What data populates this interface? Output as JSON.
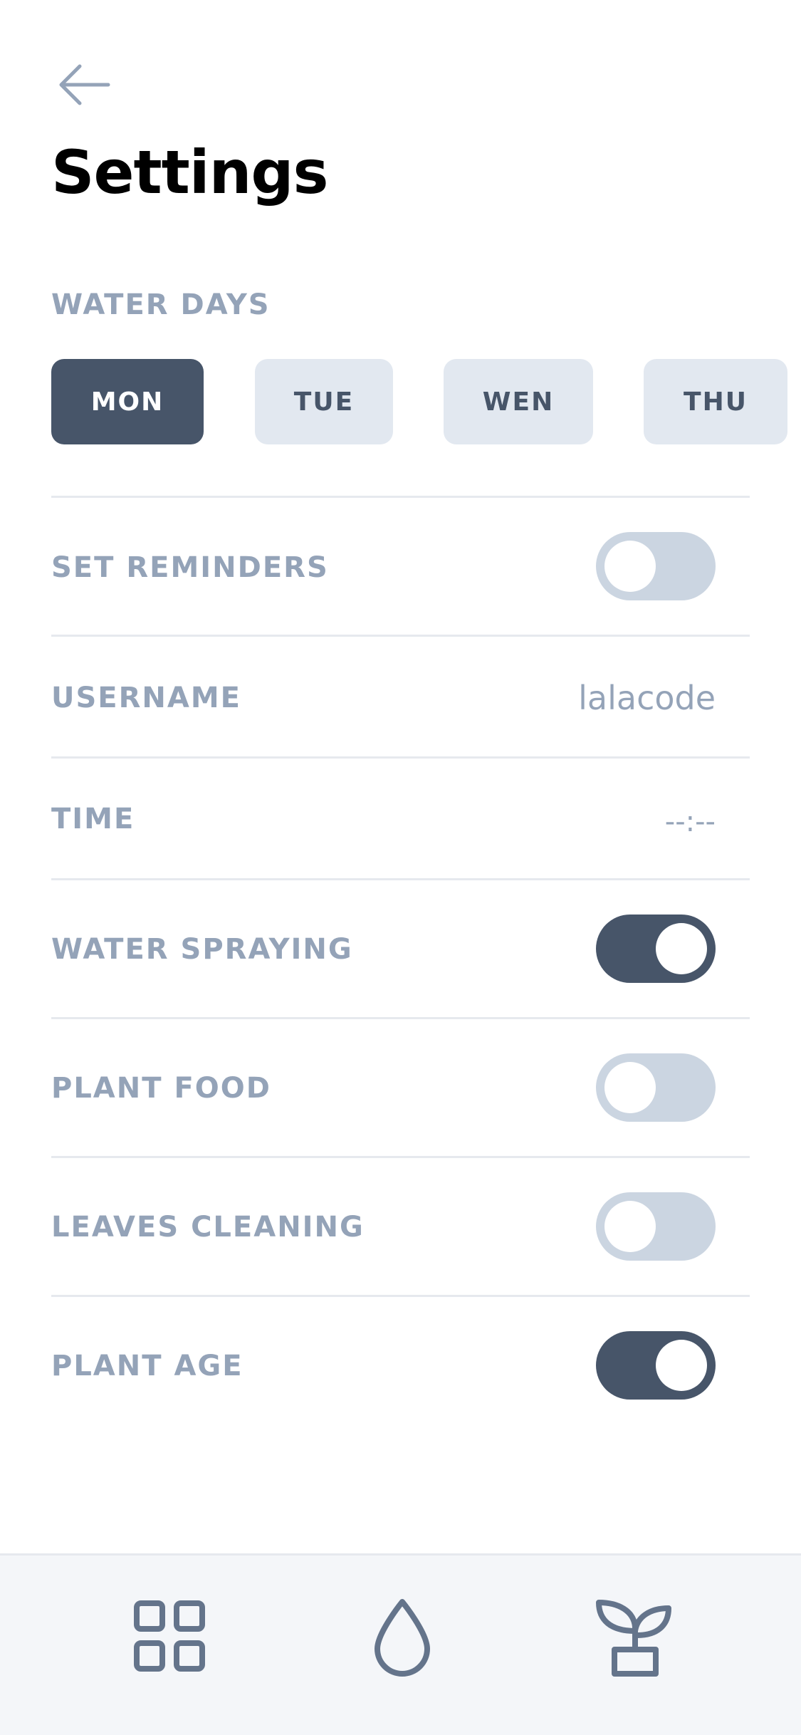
{
  "header": {
    "title": "Settings",
    "back_icon": "arrow-left-icon"
  },
  "water_days": {
    "label": "WATER DAYS",
    "days": [
      {
        "label": "MON",
        "selected": true
      },
      {
        "label": "TUE",
        "selected": false
      },
      {
        "label": "WEN",
        "selected": false
      },
      {
        "label": "THU",
        "selected": false
      }
    ]
  },
  "settings": {
    "set_reminders": {
      "label": "SET REMINDERS",
      "on": false
    },
    "username": {
      "label": "USERNAME",
      "value": "lalacode"
    },
    "time": {
      "label": "TIME",
      "value": "--:--"
    },
    "water_spraying": {
      "label": "WATER SPRAYING",
      "on": true
    },
    "plant_food": {
      "label": "PLANT FOOD",
      "on": false
    },
    "leaves_cleaning": {
      "label": "LEAVES CLEANING",
      "on": false
    },
    "plant_age": {
      "label": "PLANT AGE",
      "on": true
    }
  },
  "tabbar": {
    "items": [
      {
        "icon": "grid-icon"
      },
      {
        "icon": "water-drop-icon"
      },
      {
        "icon": "plant-pot-icon"
      }
    ]
  },
  "colors": {
    "primary": "#475569",
    "muted_label": "#94a3b8",
    "chip_bg": "#e2e8f0",
    "toggle_off": "#cbd5e1",
    "tabbar_bg": "#f4f6f9"
  }
}
